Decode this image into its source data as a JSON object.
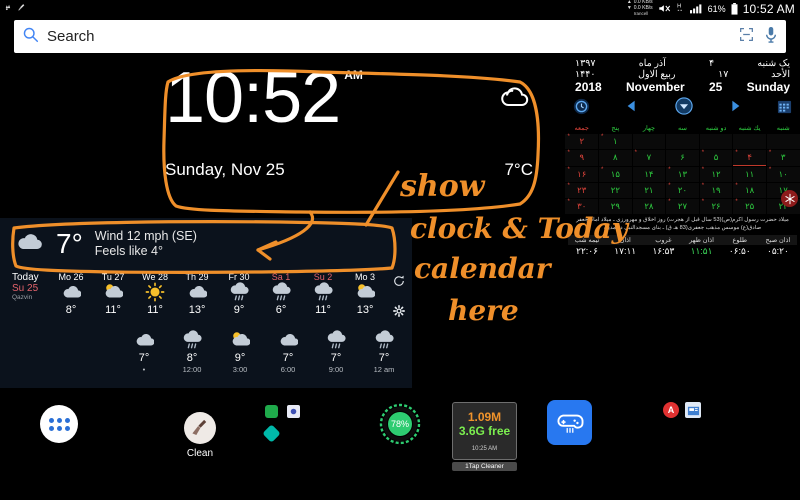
{
  "statusbar": {
    "upload_speed": "0.0 KB/s",
    "download_speed": "0.0 KB/s",
    "carrier": "Irancell",
    "network_type": "H",
    "battery_percent": "61%",
    "time": "10:52 AM",
    "icons": [
      "shortcut-icon",
      "broom-icon",
      "mute-icon",
      "signal-icon",
      "battery-icon"
    ]
  },
  "search": {
    "placeholder": "Search",
    "value": "Search",
    "icons": [
      "search-icon",
      "lens-scan-icon",
      "microphone-icon"
    ]
  },
  "clock_widget": {
    "time": "10:52",
    "ampm": "AM",
    "date": "Sunday, Nov 25",
    "temperature": "7°C",
    "condition_icon": "cloud-icon"
  },
  "weather_widget": {
    "current_temp": "7°",
    "wind": "Wind 12 mph (SE)",
    "feels_like": "Feels like 4°",
    "today_label": "Today",
    "today_date": "Su 25",
    "location": "Qazvin",
    "refresh_icon": "refresh-icon",
    "settings_icon": "gear-icon",
    "days": [
      {
        "label": "Mo 26",
        "temp": "8°",
        "icon": "cloud-icon",
        "weekend": false
      },
      {
        "label": "Tu 27",
        "temp": "11°",
        "icon": "sun-cloud-icon",
        "weekend": false
      },
      {
        "label": "We 28",
        "temp": "11°",
        "icon": "sun-icon",
        "weekend": false
      },
      {
        "label": "Th 29",
        "temp": "13°",
        "icon": "cloud-icon",
        "weekend": false
      },
      {
        "label": "Fr 30",
        "temp": "9°",
        "icon": "rain-icon",
        "weekend": false
      },
      {
        "label": "Sa 1",
        "temp": "6°",
        "icon": "rain-icon",
        "weekend": true
      },
      {
        "label": "Su 2",
        "temp": "11°",
        "icon": "rain-icon",
        "weekend": true
      },
      {
        "label": "Mo 3",
        "temp": "13°",
        "icon": "sun-cloud-icon",
        "weekend": false
      }
    ],
    "hours": [
      {
        "time": "•",
        "temp": "7°",
        "icon": "cloud-icon"
      },
      {
        "time": "12:00",
        "temp": "8°",
        "icon": "rain-icon"
      },
      {
        "time": "3:00",
        "temp": "9°",
        "icon": "sun-cloud-icon"
      },
      {
        "time": "6:00",
        "temp": "7°",
        "icon": "cloud-icon"
      },
      {
        "time": "9:00",
        "temp": "7°",
        "icon": "rain-icon"
      },
      {
        "time": "12 am",
        "temp": "7°",
        "icon": "rain-icon"
      }
    ]
  },
  "calendar_widget": {
    "persian": {
      "year": "۱۳۹۷",
      "month": "آذر ماه",
      "day": "۴",
      "weekday": "یک شنبه"
    },
    "hijri": {
      "year": "۱۴۴۰",
      "month": "ربیع الاول",
      "day": "۱۷",
      "weekday": "الأحد"
    },
    "gregorian": {
      "year": "2018",
      "month": "November",
      "day": "25",
      "weekday": "Sunday"
    },
    "nav": {
      "alarm_icon": "alarm-icon",
      "prev_icon": "prev-arrow-icon",
      "down_icon": "down-arrow-icon",
      "next_icon": "next-arrow-icon",
      "calendar_icon": "calendar-icon"
    },
    "weekdays": [
      "شنبه",
      "یك شنبه",
      "دو شنبه",
      "سه",
      "چهار",
      "پنج",
      "جمعه"
    ],
    "weeks": [
      [
        {
          "n": "",
          "type": "empty"
        },
        {
          "n": "",
          "type": "empty"
        },
        {
          "n": "",
          "type": "empty"
        },
        {
          "n": "",
          "type": "empty"
        },
        {
          "n": "",
          "type": "empty"
        },
        {
          "n": "۱",
          "type": "normal",
          "dot": true
        },
        {
          "n": "۲",
          "type": "red",
          "dot": true
        }
      ],
      [
        {
          "n": "۳",
          "type": "normal",
          "dot": true
        },
        {
          "n": "۴",
          "type": "today",
          "dot": true
        },
        {
          "n": "۵",
          "type": "normal",
          "dot": true
        },
        {
          "n": "۶",
          "type": "normal"
        },
        {
          "n": "۷",
          "type": "normal",
          "dot": true
        },
        {
          "n": "۸",
          "type": "normal"
        },
        {
          "n": "۹",
          "type": "red",
          "dot": true
        }
      ],
      [
        {
          "n": "۱۰",
          "type": "normal",
          "dot": true
        },
        {
          "n": "۱۱",
          "type": "normal"
        },
        {
          "n": "۱۲",
          "type": "normal",
          "dot": true
        },
        {
          "n": "۱۳",
          "type": "normal",
          "dot": true
        },
        {
          "n": "۱۴",
          "type": "normal"
        },
        {
          "n": "۱۵",
          "type": "normal",
          "dot": true
        },
        {
          "n": "۱۶",
          "type": "red",
          "dot": true
        }
      ],
      [
        {
          "n": "۱۷",
          "type": "normal"
        },
        {
          "n": "۱۸",
          "type": "normal",
          "dot": true
        },
        {
          "n": "۱۹",
          "type": "normal",
          "dot": true
        },
        {
          "n": "۲۰",
          "type": "normal",
          "dot": true
        },
        {
          "n": "۲۱",
          "type": "normal"
        },
        {
          "n": "۲۲",
          "type": "normal"
        },
        {
          "n": "۲۳",
          "type": "red",
          "dot": true
        }
      ],
      [
        {
          "n": "۲۴",
          "type": "normal"
        },
        {
          "n": "۲۵",
          "type": "normal",
          "dot": true
        },
        {
          "n": "۲۶",
          "type": "normal",
          "dot": true
        },
        {
          "n": "۲۷",
          "type": "normal",
          "dot": true
        },
        {
          "n": "۲۸",
          "type": "normal"
        },
        {
          "n": "۲۹",
          "type": "normal"
        },
        {
          "n": "۳۰",
          "type": "red",
          "dot": true
        }
      ]
    ],
    "event_text": "میلاد حضرت رسول اکرم(ص)(53 سال قبل از هجرت) روز اخلاق و مهرورزی ـ میلاد امام جعفر صادق(ع) موسس مذهب جعفری(83 هـ ق) ـ بنای مسجدالنبی در مدینه",
    "prayer_times": [
      {
        "name": "اذان صبح",
        "time": "۰۵:۲۰",
        "highlight": false
      },
      {
        "name": "طلوع",
        "time": "۰۶:۵۰",
        "highlight": false
      },
      {
        "name": "اذان ظهر",
        "time": "۱۱:۵۱",
        "highlight": true
      },
      {
        "name": "غروب",
        "time": "۱۶:۵۳",
        "highlight": false
      },
      {
        "name": "اذان",
        "time": "۱۷:۱۱",
        "highlight": false
      },
      {
        "name": "نیمه شب",
        "time": "۲۲:۰۶",
        "highlight": false
      }
    ]
  },
  "homescreen": {
    "app_drawer_icon": "app-drawer-icon",
    "clean_app_label": "Clean",
    "clean_app_icon": "broom-icon",
    "ring_widget_value": "78",
    "ring_widget_unit": "%",
    "cleaner_widget": {
      "memory": "1.09M",
      "free": "3.6G free",
      "time": "10:25 AM",
      "label": "1Tap Cleaner"
    },
    "game_icon": "game-controller-icon",
    "pdf_icon": "pdf-icon",
    "news_icon": "news-app-icon",
    "flake_icon": "snowflake-icon"
  },
  "annotation": {
    "color": "#ef8f2a",
    "text_show": "show",
    "text_line1": "clock & Today",
    "text_line2": "calendar",
    "text_line3": "here"
  }
}
